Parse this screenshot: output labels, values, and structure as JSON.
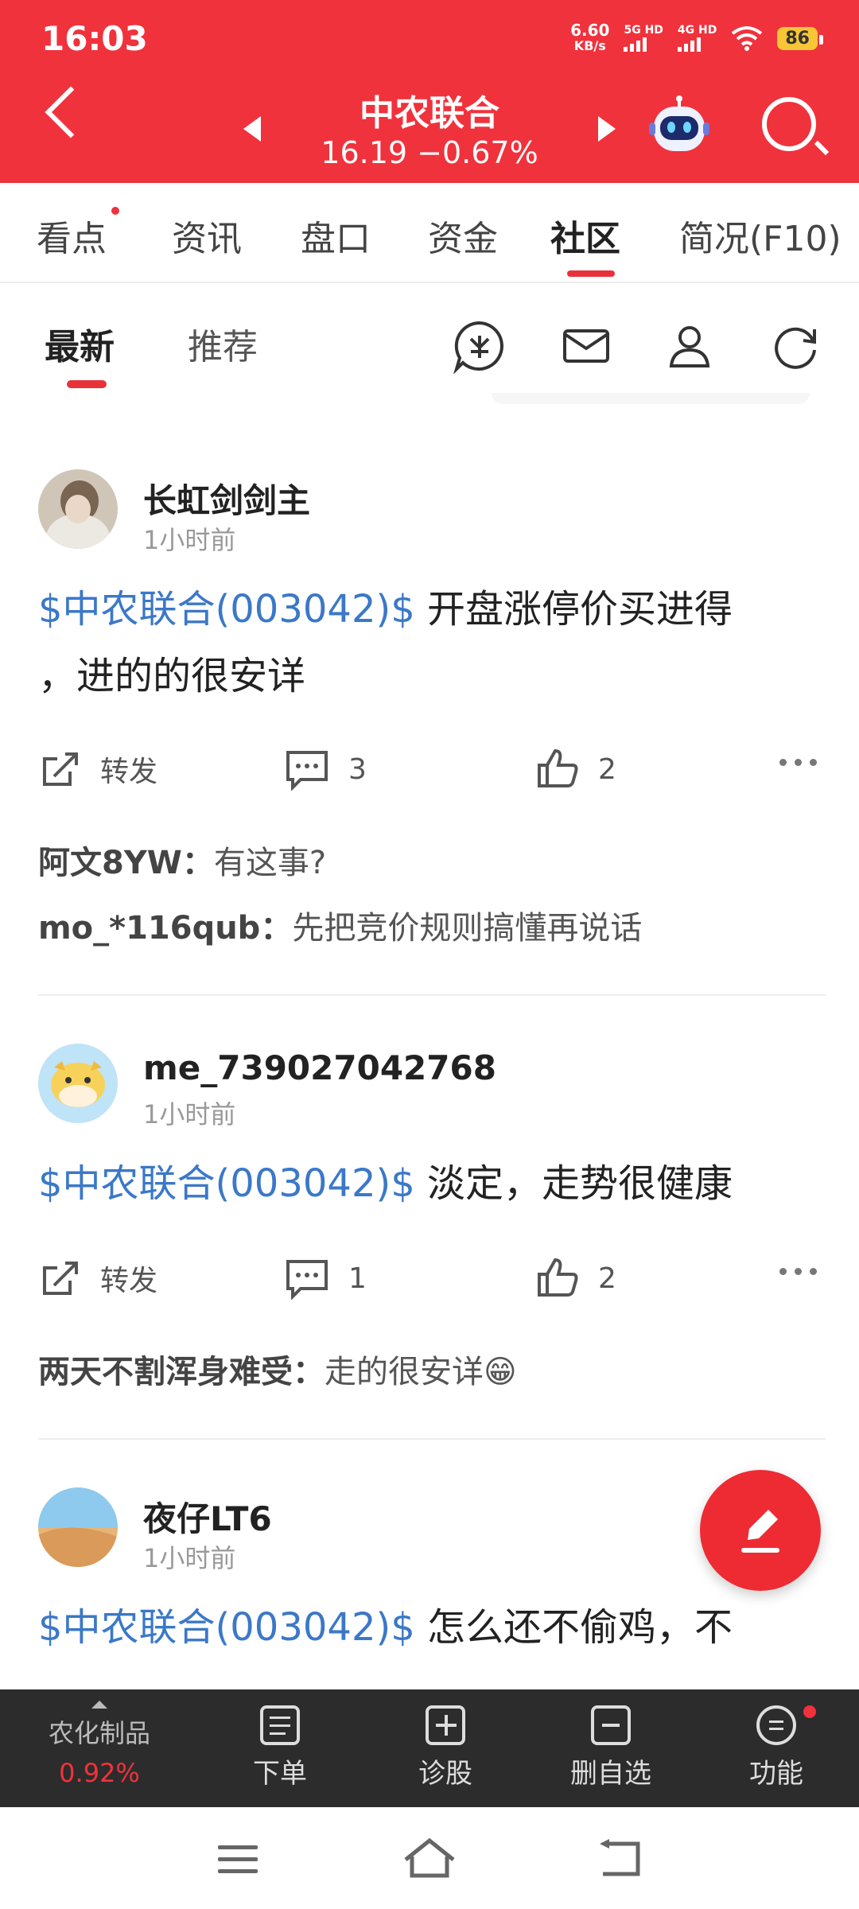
{
  "status": {
    "time": "16:03",
    "speed": "6.60",
    "speed_unit": "KB/s",
    "net1": "5G HD",
    "net2": "4G HD",
    "battery": "86"
  },
  "header": {
    "stock_name": "中农联合",
    "stock_price": "16.19 −0.67%"
  },
  "tabs": [
    {
      "label": "看点"
    },
    {
      "label": "资讯"
    },
    {
      "label": "盘口"
    },
    {
      "label": "资金"
    },
    {
      "label": "社区"
    },
    {
      "label": "简况(F10)"
    }
  ],
  "subtabs": [
    {
      "label": "最新"
    },
    {
      "label": "推荐"
    }
  ],
  "posts": [
    {
      "username": "长虹剑剑主",
      "time": "1小时前",
      "tag": "$中农联合(003042)$",
      "text_line1": " 开盘涨停价买进得",
      "text_line2": "，进的的很安详",
      "repost": "转发",
      "comments": "3",
      "likes": "2",
      "replies": [
        {
          "user": "阿文8YW：",
          "text": "有这事?"
        },
        {
          "user": "mo_*116qub：",
          "text": "先把竞价规则搞懂再说话"
        }
      ]
    },
    {
      "username": "me_739027042768",
      "time": "1小时前",
      "tag": "$中农联合(003042)$",
      "text_line1": " 淡定，走势很健康",
      "repost": "转发",
      "comments": "1",
      "likes": "2",
      "replies": [
        {
          "user": "两天不割浑身难受：",
          "text": "走的很安详😁"
        }
      ]
    },
    {
      "username": "夜仔LT6",
      "time": "1小时前",
      "tag": "$中农联合(003042)$",
      "text_line1": " 怎么还不偷鸡，不"
    }
  ],
  "bottom": {
    "sector_name": "农化制品",
    "sector_change": "0.92%",
    "items": [
      {
        "label": "下单"
      },
      {
        "label": "诊股"
      },
      {
        "label": "删自选"
      },
      {
        "label": "功能"
      }
    ]
  },
  "colors": {
    "brand_red": "#f0323c",
    "tag_blue": "#3b78c8",
    "toolbar_dark": "#2c2c2c"
  }
}
